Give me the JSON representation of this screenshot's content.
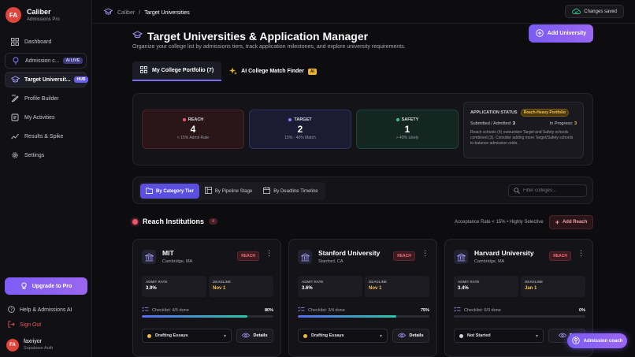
{
  "brand": {
    "initials": "FA",
    "name": "Caliber",
    "sub": "Admissions Pro"
  },
  "sidebar": {
    "items": [
      {
        "label": "Dashboard",
        "icon": "dashboard-icon"
      },
      {
        "label": "Admission c...",
        "icon": "admission-icon",
        "pill": "AI LIVE"
      },
      {
        "label": "Target Universit...",
        "icon": "graduation-cap-icon",
        "pill": "HUB"
      },
      {
        "label": "Profile Builder",
        "icon": "profile-icon"
      },
      {
        "label": "My Activities",
        "icon": "activities-icon"
      },
      {
        "label": "Results & Spike",
        "icon": "trend-icon"
      },
      {
        "label": "Settings",
        "icon": "gear-icon"
      }
    ],
    "upgrade": "Upgrade to Pro",
    "help": "Help & Admissions AI",
    "signout": "Sign Out",
    "user": {
      "initials": "FA",
      "name": "faxriyor",
      "sub": "Supabase Auth"
    }
  },
  "topbar": {
    "crumb_root": "Caliber",
    "crumb_sep": "/",
    "crumb_current": "Target Universities",
    "saved": "Changes saved"
  },
  "header": {
    "title": "Target Universities & Application Manager",
    "subtitle": "Organize your college list by admissions tiers, track application milestones, and explore university requirements.",
    "add_button": "Add University"
  },
  "tabs": [
    {
      "label": "My College Portfolio (7)"
    },
    {
      "label": "AI College Match Finder",
      "badge": "AI"
    }
  ],
  "stats": {
    "reach": {
      "label": "REACH",
      "value": "4",
      "sub": "< 15% Admit Rate"
    },
    "target": {
      "label": "TARGET",
      "value": "2",
      "sub": "15% - 40% Match"
    },
    "safety": {
      "label": "SAFETY",
      "value": "1",
      "sub": "> 40% Likely"
    }
  },
  "app_status": {
    "label": "APPLICATION STATUS",
    "badge": "Reach-Heavy Portfolio",
    "submitted_label": "Submitted / Admitted:",
    "submitted_value": "3",
    "progress_label": "In Progress:",
    "progress_value": "3",
    "note": "Reach schools (4) outnumber Target and Safety schools combined (3). Consider adding more Target/Safety schools to balance admission odds."
  },
  "filters": {
    "buttons": [
      "By Category Tier",
      "By Pipeline Stage",
      "By Deadline Timeline"
    ],
    "search_placeholder": "Filter colleges..."
  },
  "section": {
    "title": "Reach Institutions",
    "count": "4",
    "acceptance": "Acceptance Rate < 15% • Highly Selective",
    "add_button": "Add Reach"
  },
  "cards": [
    {
      "name": "MIT",
      "location": "Cambridge, MA",
      "badge": "REACH",
      "admit_label": "ADMIT RATE",
      "admit": "3.9%",
      "deadline_label": "DEADLINE",
      "deadline": "Nov 1",
      "checklist": "Checklist: 4/5 done",
      "pct": "80%",
      "progress": 0.8,
      "bar_color": "#2ec4a8",
      "status": "Drafting Essays",
      "status_color": "#f5b942",
      "details": "Details"
    },
    {
      "name": "Stanford University",
      "location": "Stanford, CA",
      "badge": "REACH",
      "admit_label": "ADMIT RATE",
      "admit": "3.6%",
      "deadline_label": "DEADLINE",
      "deadline": "Nov 1",
      "checklist": "Checklist: 3/4 done",
      "pct": "75%",
      "progress": 0.75,
      "bar_color": "#2ec4a8",
      "status": "Drafting Essays",
      "status_color": "#f5b942",
      "details": "Details"
    },
    {
      "name": "Harvard University",
      "location": "Cambridge, MA",
      "badge": "REACH",
      "admit_label": "ADMIT RATE",
      "admit": "3.4%",
      "deadline_label": "DEADLINE",
      "deadline": "Jan 1",
      "checklist": "Checklist: 0/3 done",
      "pct": "0%",
      "progress": 0,
      "bar_color": "#2ec4a8",
      "status": "Not Started",
      "status_color": "#d0d0d8",
      "details": "De"
    }
  ],
  "coach": "Admission coach",
  "colors": {
    "accent": "#7a5cf6",
    "reach": "#f0546b",
    "target": "#7a8cf5",
    "safety": "#2ecc8a",
    "warning": "#f5c24a"
  }
}
